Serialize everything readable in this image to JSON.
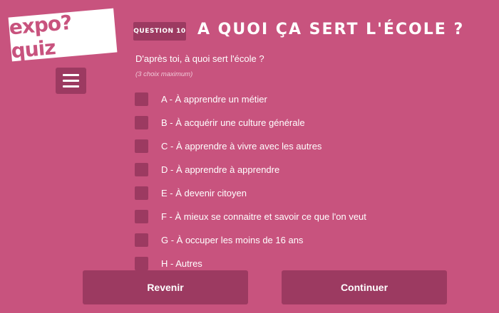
{
  "logo": {
    "text": "expo?quiz"
  },
  "question": {
    "badge": "QUESTION 10",
    "title": "A QUOI ÇA SERT L'ÉCOLE ?",
    "prompt": "D'après toi, à quoi sert l'école ?",
    "hint": "(3 choix maximum)"
  },
  "options": [
    {
      "label": "A - À apprendre un métier",
      "checked": false
    },
    {
      "label": "B - À acquérir une culture générale",
      "checked": false
    },
    {
      "label": "C - À apprendre à vivre avec les autres",
      "checked": false
    },
    {
      "label": "D - À apprendre à apprendre",
      "checked": false
    },
    {
      "label": "E - À devenir citoyen",
      "checked": false
    },
    {
      "label": "F - À mieux se connaitre et savoir ce que l'on veut",
      "checked": false
    },
    {
      "label": "G - À occuper les moins de 16 ans",
      "checked": false
    },
    {
      "label": "H - Autres",
      "checked": false
    }
  ],
  "buttons": {
    "back": "Revenir",
    "next": "Continuer"
  },
  "colors": {
    "background": "#c8537e",
    "accent_dark": "#9c3a61",
    "text": "#ffffff"
  },
  "icons": {
    "menu": "hamburger-menu-icon"
  }
}
